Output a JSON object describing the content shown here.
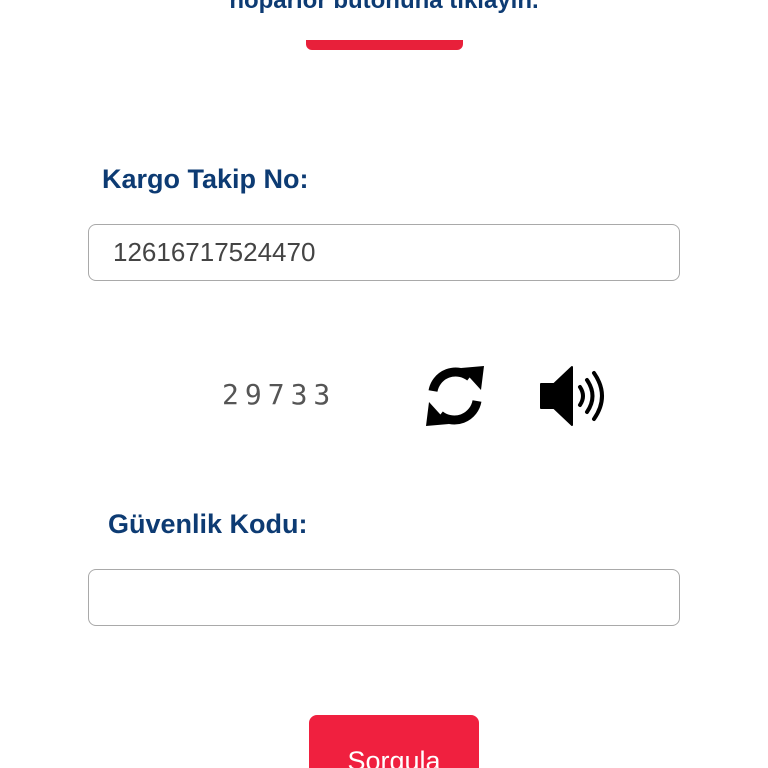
{
  "header": {
    "instruction_text": "hoparlör butonuna tıklayın."
  },
  "form": {
    "tracking_label": "Kargo Takip No:",
    "tracking_value": "12616717524470",
    "captcha_code": "29733",
    "refresh_icon": "refresh-icon",
    "audio_icon": "speaker-icon",
    "security_label": "Güvenlik Kodu:",
    "security_value": "",
    "submit_label": "Sorgula"
  },
  "colors": {
    "label_blue": "#0d3b73",
    "accent_red": "#f0203f",
    "input_border": "#a9a9a9"
  }
}
